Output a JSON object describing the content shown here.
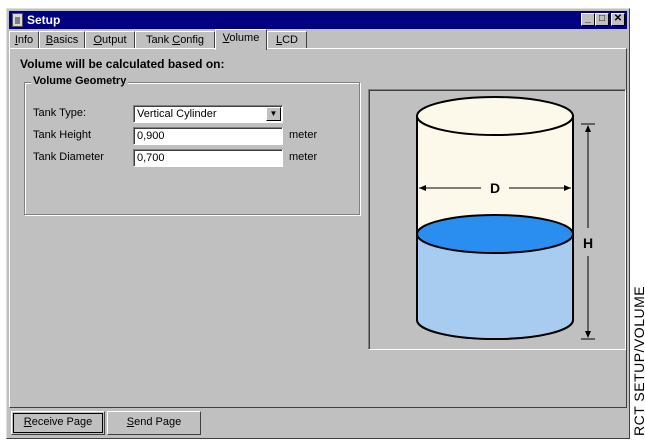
{
  "window": {
    "title": "Setup"
  },
  "title_buttons": {
    "minimize": "_",
    "maximize": "□",
    "close": "✕"
  },
  "tabs": [
    {
      "label": "Info",
      "accel": "I",
      "rest": "nfo"
    },
    {
      "label": "Basics",
      "accel": "B",
      "rest": "asics"
    },
    {
      "label": "Output",
      "accel": "O",
      "rest": "utput"
    },
    {
      "label": "Tank Config",
      "pre": "Tank ",
      "accel": "C",
      "rest": "onfig"
    },
    {
      "label": "Volume",
      "accel": "V",
      "rest": "olume",
      "active": true
    },
    {
      "label": "LCD",
      "accel": "L",
      "rest": "CD"
    }
  ],
  "volume": {
    "heading": "Volume will be calculated based on:",
    "group_title": "Volume Geometry",
    "tank_type_label": "Tank Type:",
    "tank_type_value": "Vertical Cylinder",
    "tank_height_label": "Tank Height",
    "tank_height_value": "0,900",
    "tank_height_unit": "meter",
    "tank_diameter_label": "Tank Diameter",
    "tank_diameter_value": "0,700",
    "tank_diameter_unit": "meter"
  },
  "diagram": {
    "diameter_label": "D",
    "height_label": "H",
    "colors": {
      "tank_body": "#fdf9ea",
      "liquid": "#a8cbf0",
      "liquid_surface": "#2a8ef0"
    }
  },
  "buttons": {
    "receive": {
      "accel": "R",
      "rest": "eceive Page"
    },
    "send": {
      "accel": "S",
      "rest": "end Page"
    }
  },
  "side_caption": "RCT SETUP/VOLUME"
}
